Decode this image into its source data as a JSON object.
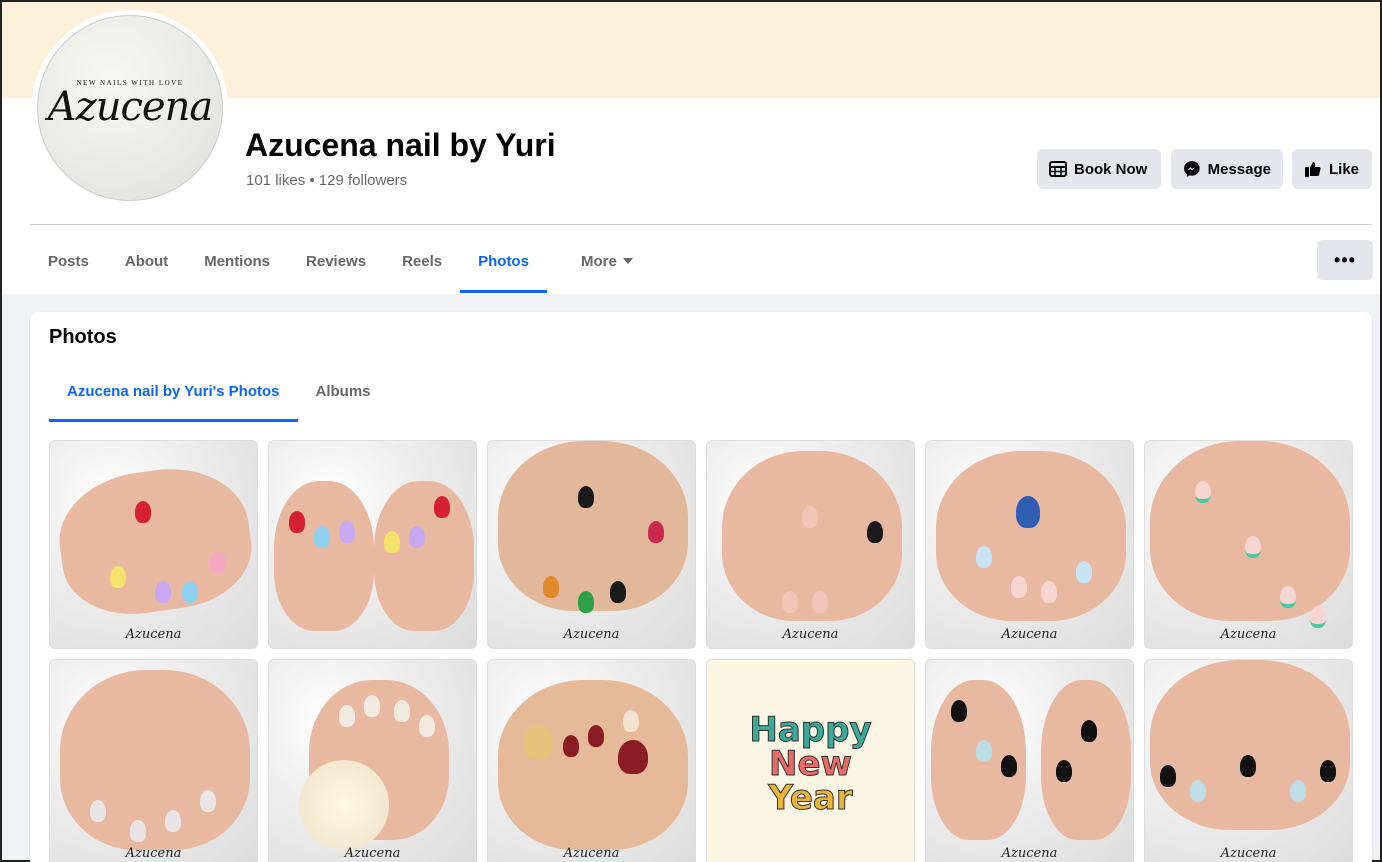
{
  "page": {
    "name": "Azucena nail by Yuri",
    "stats": "101 likes • 129 followers",
    "avatar": {
      "tagline": "NEW NAILS WITH LOVE",
      "brand": "Azucena"
    }
  },
  "actions": {
    "book_now": "Book Now",
    "message": "Message",
    "like": "Like",
    "more_options": "•••"
  },
  "tabs": [
    {
      "label": "Posts"
    },
    {
      "label": "About"
    },
    {
      "label": "Mentions"
    },
    {
      "label": "Reviews"
    },
    {
      "label": "Reels"
    },
    {
      "label": "Photos"
    },
    {
      "label": "More"
    }
  ],
  "photos_section": {
    "title": "Photos",
    "subtabs": [
      {
        "label": "Azucena nail by Yuri's Photos"
      },
      {
        "label": "Albums"
      }
    ],
    "watermark": "Azucena",
    "new_year_text": [
      "Happy",
      "New",
      "Year"
    ]
  },
  "colors": {
    "accent": "#0866ff",
    "cover": "#fdf0da",
    "button_bg": "#e4e6eb"
  }
}
